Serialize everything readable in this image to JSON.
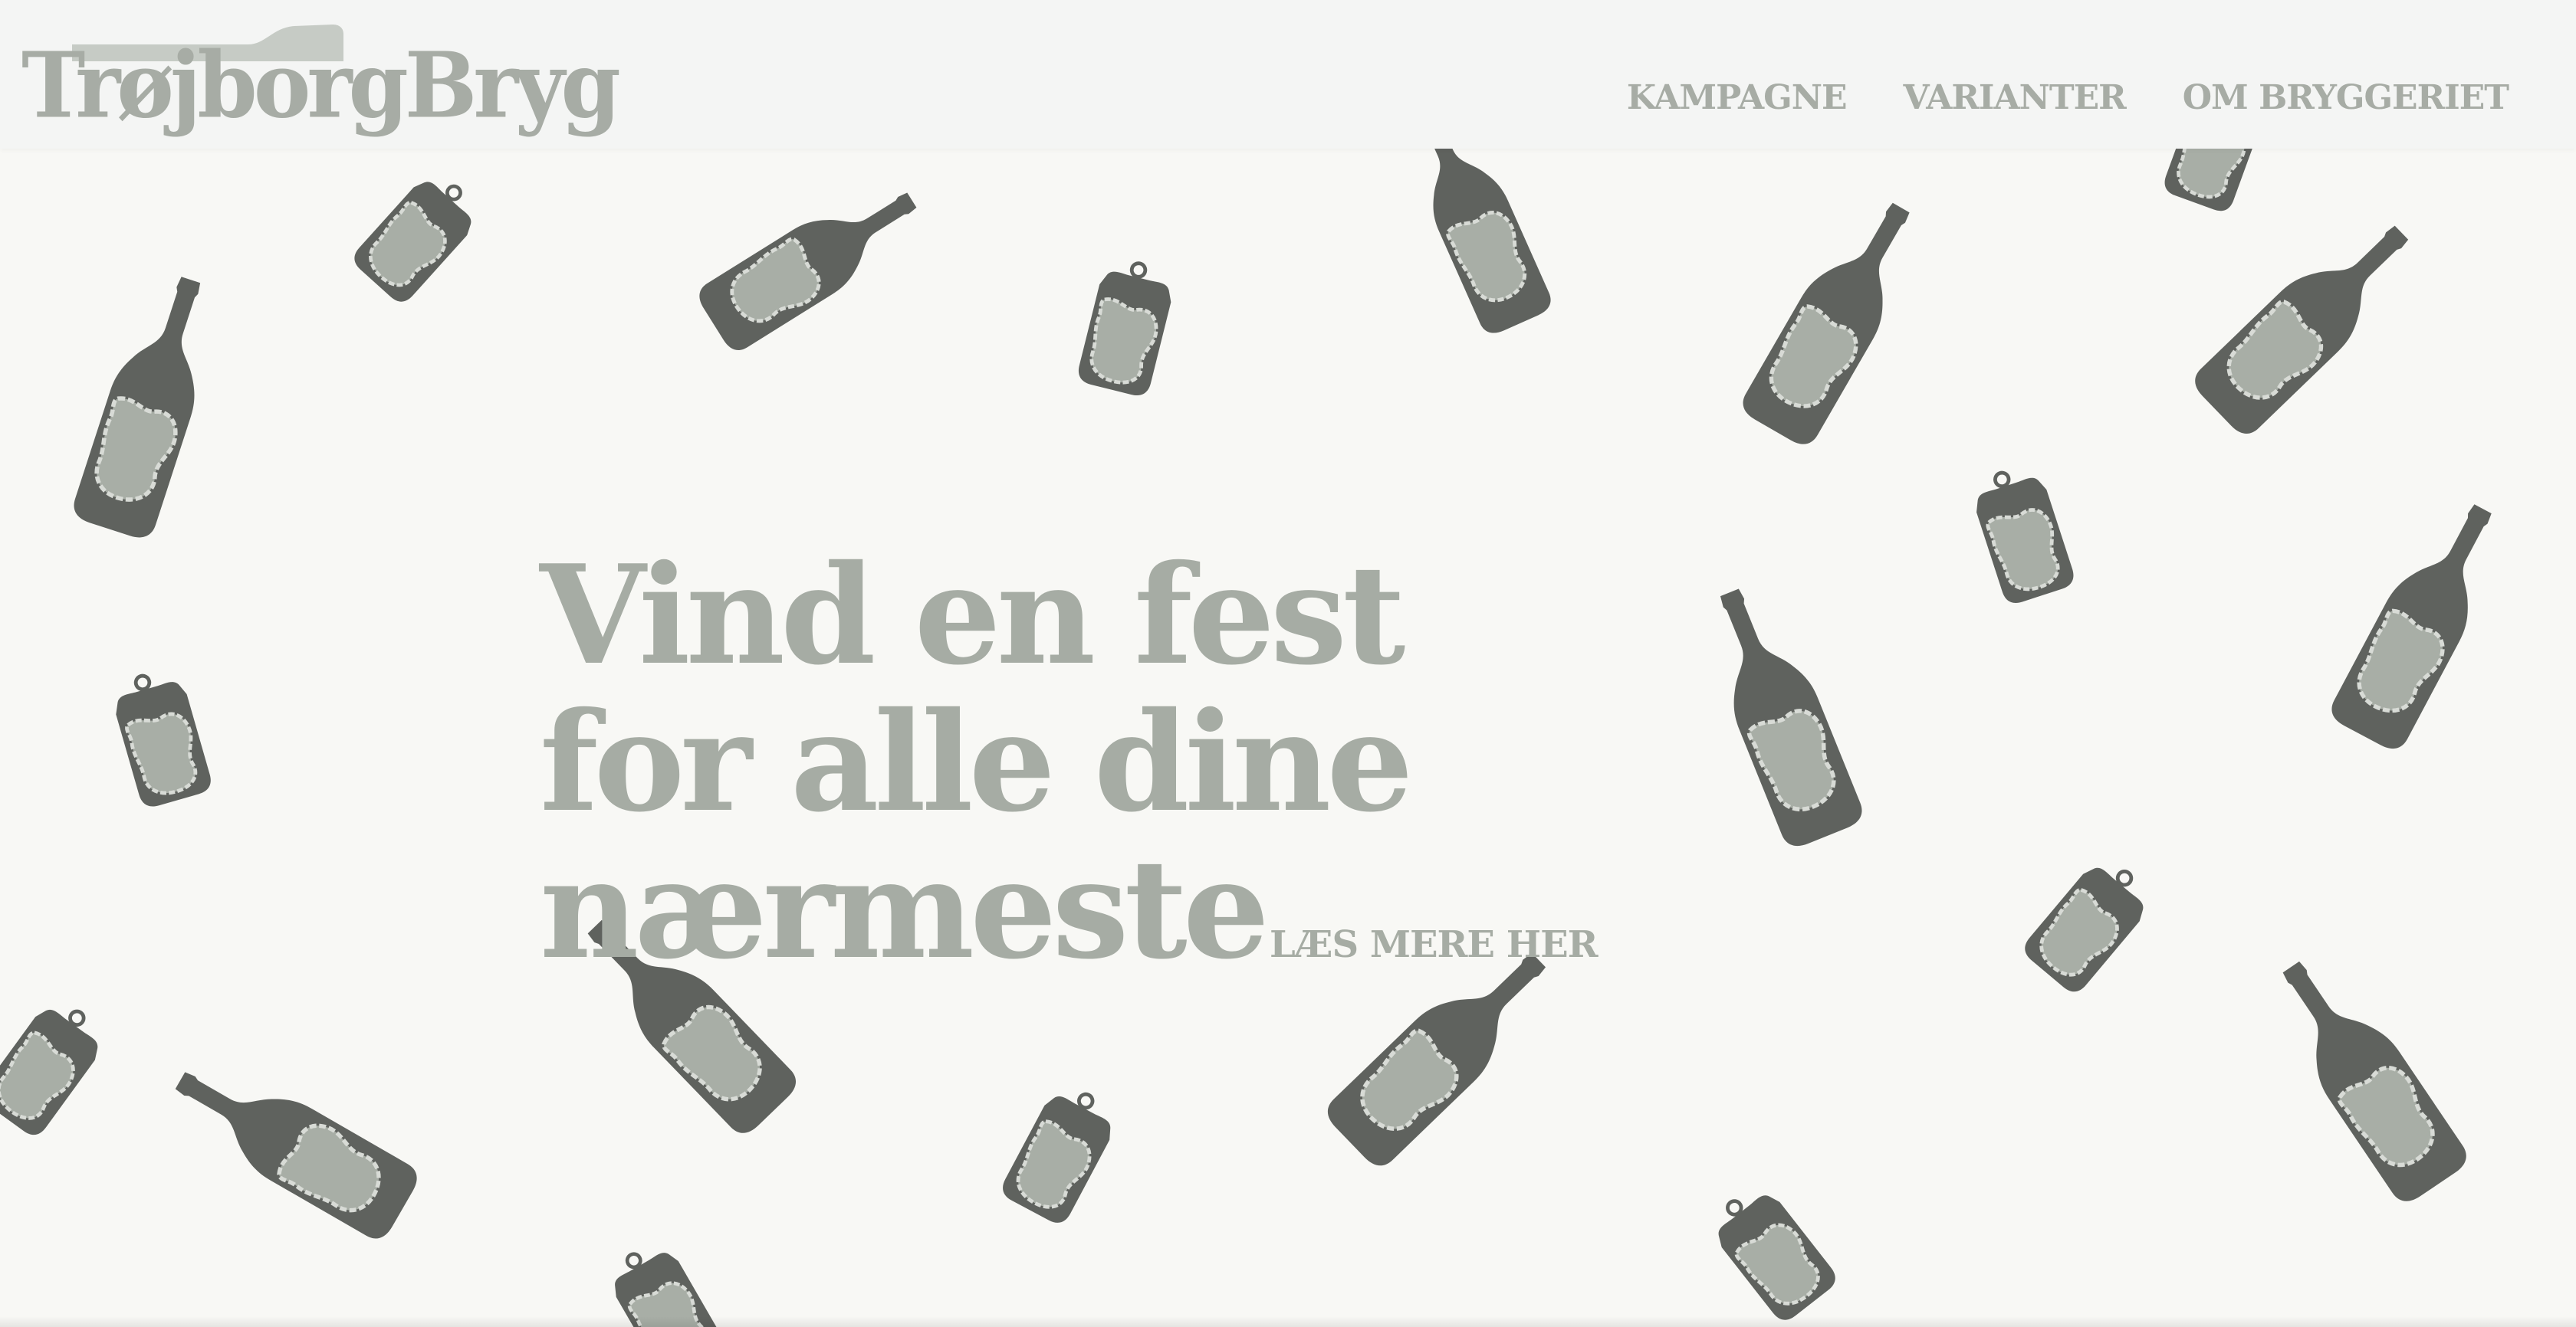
{
  "brand": {
    "logo_text": "TrøjborgBryg"
  },
  "nav": {
    "items": [
      {
        "label": "KAMPAGNE"
      },
      {
        "label": "VARIANTER"
      },
      {
        "label": "OM BRYGGERIET"
      }
    ]
  },
  "hero": {
    "headline_lines": [
      "Vind en fest",
      "for alle dine",
      "nærmeste"
    ],
    "read_more": "LÆS MERE HER"
  },
  "colors": {
    "background": "#f8f8f5",
    "bottle": "#5f625e",
    "label": "#a8aea6",
    "text": "#a6aca4"
  },
  "icons": {
    "bottle": "bottle-icon",
    "can": "can-icon"
  }
}
